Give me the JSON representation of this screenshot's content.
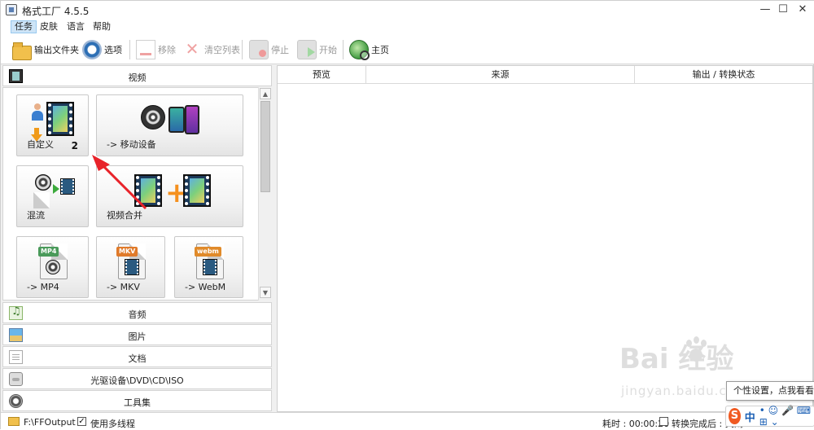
{
  "window": {
    "title": "格式工厂 4.5.5",
    "minimize": "—",
    "maximize": "☐",
    "close": "✕"
  },
  "menu": {
    "items": [
      "任务",
      "皮肤",
      "语言",
      "帮助"
    ]
  },
  "toolbar": {
    "output_folder": "输出文件夹",
    "options": "选项",
    "remove": "移除",
    "clear_list": "清空列表",
    "stop": "停止",
    "start": "开始",
    "home": "主页"
  },
  "categories": {
    "video": "视频",
    "audio": "音频",
    "picture": "图片",
    "document": "文档",
    "disc": "光驱设备\\DVD\\CD\\ISO",
    "tools": "工具集"
  },
  "tiles": {
    "custom": {
      "label": "自定义",
      "badge": "2"
    },
    "mobile": {
      "label": "-> 移动设备"
    },
    "mix": {
      "label": "混流"
    },
    "merge": {
      "label": "视频合并"
    },
    "mp4": {
      "label": "-> MP4",
      "tag": "MP4"
    },
    "mkv": {
      "label": "-> MKV",
      "tag": "MKV"
    },
    "webm": {
      "label": "-> WebM",
      "tag": "webm"
    }
  },
  "table": {
    "columns": [
      "预览",
      "来源",
      "输出 / 转换状态"
    ]
  },
  "status": {
    "output_path": "F:\\FFOutput",
    "multithread_label": "使用多线程",
    "multithread_checked": true,
    "elapsed_label": "耗时 : 00:00:20",
    "after_convert_label": "转换完成后 : 关闭"
  },
  "tooltip": {
    "text": "个性设置，点我看看"
  },
  "ime": {
    "logo": "S",
    "mode": "中",
    "glyphs": "• ☺ 🎤 ⌨ ⊞ ⌄"
  },
  "watermark": {
    "brand": "Bai  经验",
    "url": "jingyan.baidu.com"
  },
  "colors": {
    "accent": "#cde4f7",
    "annotation_arrow": "#e8232a",
    "ime_brand": "#f05a22"
  }
}
